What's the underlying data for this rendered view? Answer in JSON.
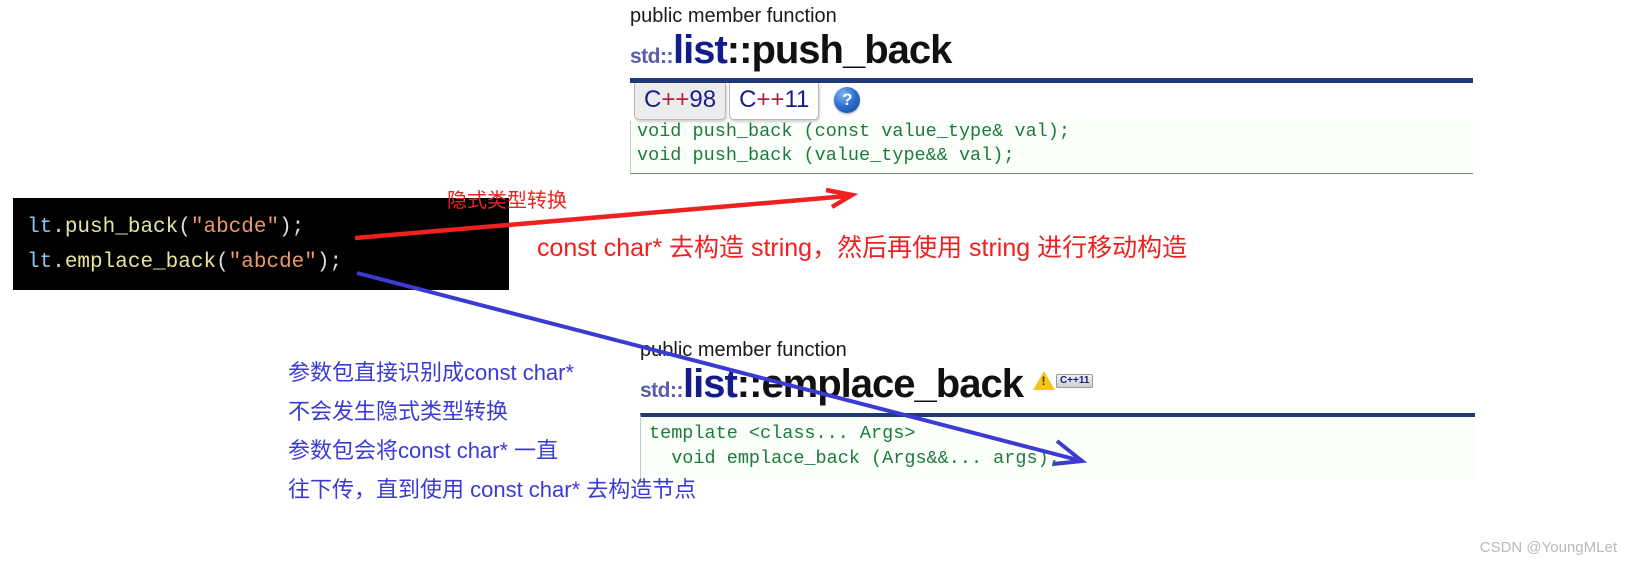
{
  "push_back_ref": {
    "kind": "public member function",
    "namespace": "std::",
    "class": "list",
    "separator": "::",
    "function": "push_back",
    "tabs": [
      {
        "label_prefix": "C",
        "label_plus": "++",
        "label_suffix": "98",
        "state": "inactive"
      },
      {
        "label_prefix": "C",
        "label_plus": "++",
        "label_suffix": "11",
        "state": "active"
      }
    ],
    "help_icon_glyph": "?",
    "signature_lines": [
      "void push_back (const value_type& val);",
      "void push_back (value_type&& val);"
    ]
  },
  "emplace_back_ref": {
    "kind": "public member function",
    "namespace": "std::",
    "class": "list",
    "separator": "::",
    "function": "emplace_back",
    "badge": {
      "warning_icon": "warning-triangle-icon",
      "warning_glyph": "!",
      "tag_label": "C++11"
    },
    "signature_lines": [
      "template <class... Args>",
      "  void emplace_back (Args&&... args);"
    ]
  },
  "code_snippet": {
    "lines": [
      {
        "var": "lt",
        "dot": ".",
        "fn": "push_back",
        "open": "(",
        "str": "\"abcde\"",
        "close": ");"
      },
      {
        "var": "lt",
        "dot": ".",
        "fn": "emplace_back",
        "open": "(",
        "str": "\"abcde\"",
        "close": ");"
      }
    ]
  },
  "annotations": {
    "red_label": "隐式类型转换",
    "red_explanation": "const char* 去构造 string，然后再使用 string 进行移动构造",
    "blue_lines": [
      "参数包直接识别成const char*",
      "不会发生隐式类型转换",
      "参数包会将const char* 一直",
      "往下传，直到使用 const char* 去构造节点"
    ]
  },
  "watermark": "CSDN @YoungMLet",
  "colors": {
    "red_annotation": "#ef2020",
    "blue_annotation": "#3b3bd4",
    "code_green": "#1e7a3c",
    "title_blue": "#141c8c",
    "rule_blue": "#1f3a77"
  }
}
